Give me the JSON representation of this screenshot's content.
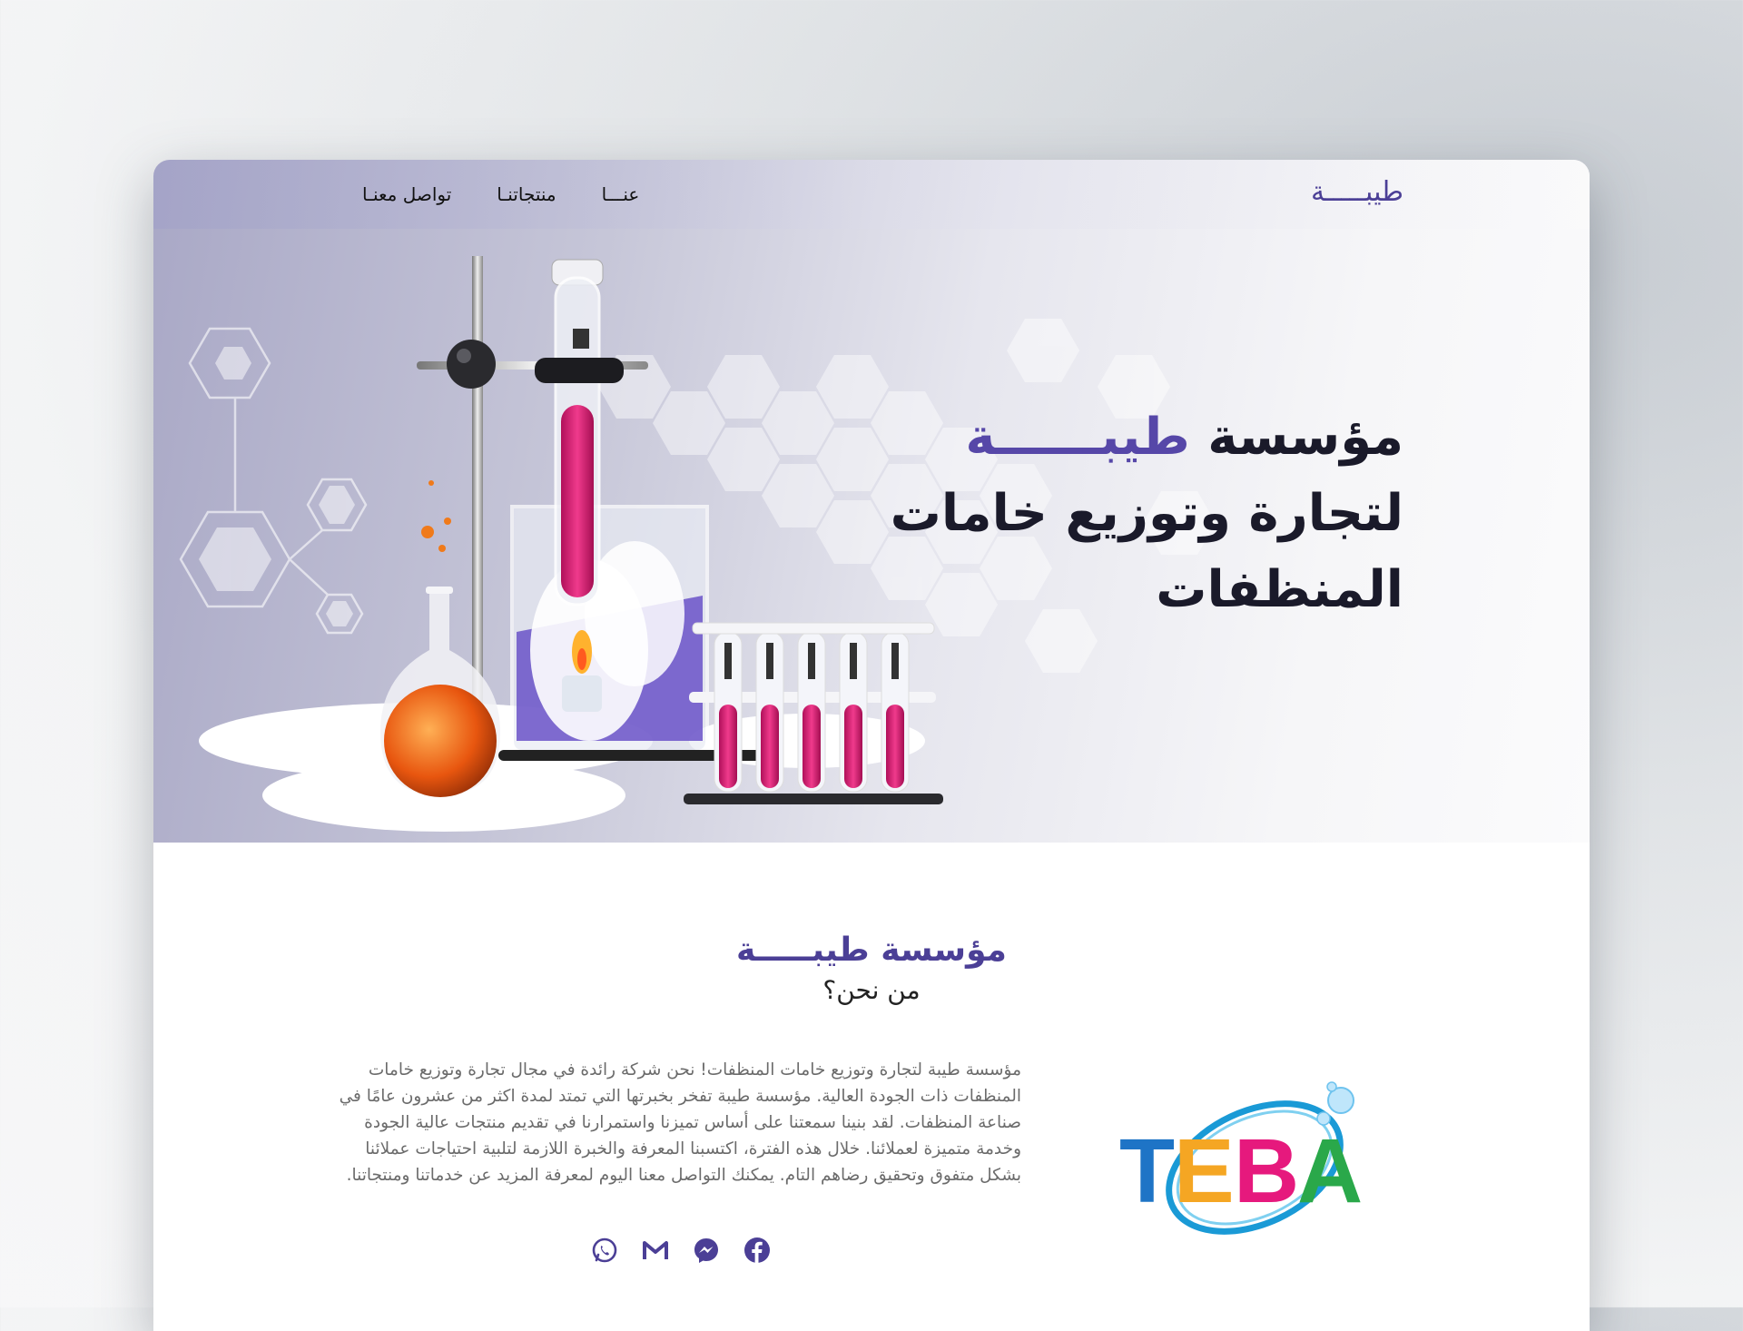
{
  "nav": {
    "brand": "طيبـــــة",
    "links": [
      {
        "label": "تواصل معنـا"
      },
      {
        "label": "منتجاتنـا"
      },
      {
        "label": "عنـــا"
      }
    ]
  },
  "hero": {
    "title_line1_prefix": "مؤسسة ",
    "title_line1_accent": "طيبــــــة",
    "title_line2": "لتجارة وتوزيع خامات",
    "title_line3": "المنظفات"
  },
  "about": {
    "heading": "مؤسسة طيبـــــة",
    "subheading": "من نحن؟",
    "body": "مؤسسة طيبة لتجارة وتوزيع خامات المنظفات! نحن شركة رائدة في مجال تجارة وتوزيع خامات المنظفات ذات الجودة العالية. مؤسسة طيبة تفخر بخبرتها التي تمتد لمدة اكثر من عشرون عامًا في صناعة المنظفات. لقد بنينا سمعتنا على أساس تميزنا واستمرارنا في تقديم منتجات عالية الجودة وخدمة متميزة لعملائنا. خلال هذه الفترة، اكتسبنا المعرفة والخبرة اللازمة لتلبية احتياجات عملائنا بشكل متفوق وتحقيق رضاهم التام. يمكنك التواصل معنا اليوم لمعرفة المزيد عن خدماتنا ومنتجاتنا.",
    "socials": [
      {
        "icon": "whatsapp-icon"
      },
      {
        "icon": "gmail-icon"
      },
      {
        "icon": "messenger-icon"
      },
      {
        "icon": "facebook-icon"
      }
    ]
  },
  "logo": {
    "text": "TEBA"
  },
  "colors": {
    "accent": "#4b3f96",
    "title": "#1a1a2a",
    "body_text": "#6b6b6b",
    "logo_t": "#1e74c6",
    "logo_e": "#f5a623",
    "logo_b": "#e6197d",
    "logo_a": "#2aa84a"
  }
}
